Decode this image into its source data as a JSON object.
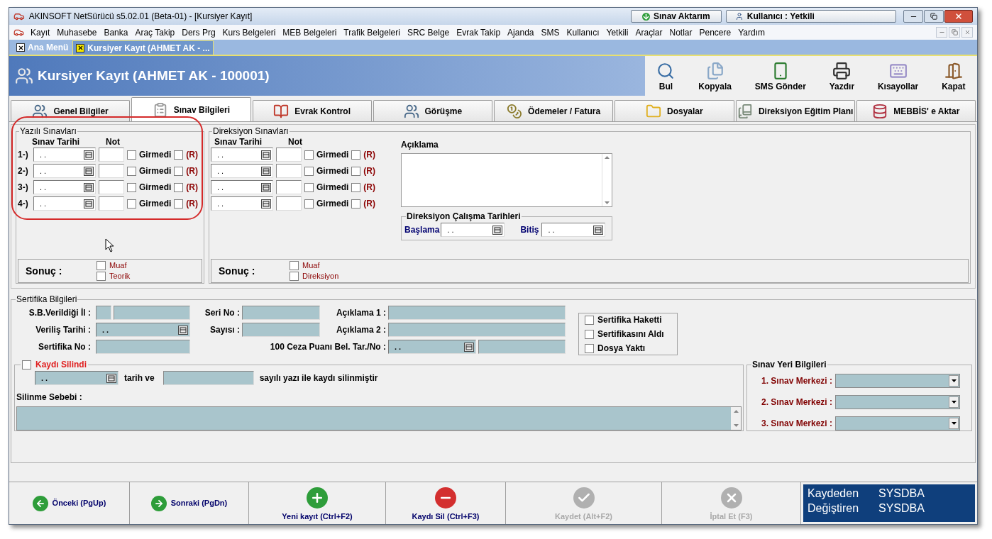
{
  "window": {
    "title": "AKINSOFT NetSürücü s5.02.01 (Beta-01) - [Kursiyer Kayıt]",
    "title_buttons": [
      {
        "label": "Sınav Aktarım",
        "kind": "transfer"
      },
      {
        "label": "Kullanıcı : Yetkili",
        "kind": "user"
      }
    ]
  },
  "menu": [
    "Kayıt",
    "Muhasebe",
    "Banka",
    "Araç Takip",
    "Ders Prg",
    "Kurs Belgeleri",
    "MEB Belgeleri",
    "Trafik Belgeleri",
    "SRC Belge",
    "Evrak Takip",
    "Ajanda",
    "SMS",
    "Kullanıcı",
    "Yetkili",
    "Araçlar",
    "Notlar",
    "Pencere",
    "Yardım"
  ],
  "doc_tabs": [
    {
      "label": "Ana Menü",
      "selected": false
    },
    {
      "label": "Kursiyer Kayıt (AHMET AK - ...",
      "selected": true
    }
  ],
  "header": {
    "title": "Kursiyer Kayıt (AHMET AK - 100001)",
    "tools": [
      {
        "label": "Bul",
        "kind": "find"
      },
      {
        "label": "Kopyala",
        "kind": "copy"
      },
      {
        "label": "SMS Gönder",
        "kind": "sms"
      },
      {
        "label": "Yazdır",
        "kind": "print"
      },
      {
        "label": "Kısayollar",
        "kind": "keyboard"
      },
      {
        "label": "Kapat",
        "kind": "close"
      }
    ]
  },
  "tabs": [
    {
      "label": "Genel Bilgiler",
      "kind": "people",
      "selected": false
    },
    {
      "label": "Sınav Bilgileri",
      "kind": "list",
      "selected": true
    },
    {
      "label": "Evrak Kontrol",
      "kind": "book",
      "selected": false
    },
    {
      "label": "Görüşme",
      "kind": "people",
      "selected": false
    },
    {
      "label": "Ödemeler / Fatura",
      "kind": "money",
      "selected": false
    },
    {
      "label": "Dosyalar",
      "kind": "folder",
      "selected": false
    },
    {
      "label": "Direksiyon Eğitim Planı",
      "kind": "plan",
      "selected": false
    },
    {
      "label": "MEBBİS' e Aktar",
      "kind": "export",
      "selected": false
    }
  ],
  "written_exams": {
    "title": "Yazılı Sınavları",
    "date_header": "Sınav Tarihi",
    "grade_header": "Not",
    "rows": [
      {
        "label": "1-)",
        "date": ". .",
        "absent_label": "Girmedi",
        "absent": false,
        "r_label": "(R)",
        "r": false
      },
      {
        "label": "2-)",
        "date": ". .",
        "absent_label": "Girmedi",
        "absent": false,
        "r_label": "(R)",
        "r": false
      },
      {
        "label": "3-)",
        "date": ". .",
        "absent_label": "Girmedi",
        "absent": false,
        "r_label": "(R)",
        "r": false
      },
      {
        "label": "4-)",
        "date": ". .",
        "absent_label": "Girmedi",
        "absent": false,
        "r_label": "(R)",
        "r": false
      }
    ],
    "result_label": "Sonuç :",
    "result_options": [
      {
        "label": "Muaf",
        "checked": false
      },
      {
        "label": "Teorik",
        "checked": false
      }
    ]
  },
  "driving_exams": {
    "title": "Direksiyon Sınavları",
    "date_header": "Sınav Tarihi",
    "grade_header": "Not",
    "rows": [
      {
        "label": "",
        "date": ". .",
        "absent_label": "Girmedi",
        "absent": false,
        "r_label": "(R)",
        "r": false
      },
      {
        "label": "",
        "date": ". .",
        "absent_label": "Girmedi",
        "absent": false,
        "r_label": "(R)",
        "r": false
      },
      {
        "label": "",
        "date": ". .",
        "absent_label": "Girmedi",
        "absent": false,
        "r_label": "(R)",
        "r": false
      },
      {
        "label": "",
        "date": ". .",
        "absent_label": "Girmedi",
        "absent": false,
        "r_label": "(R)",
        "r": false
      }
    ],
    "result_label": "Sonuç :",
    "result_options": [
      {
        "label": "Muaf",
        "checked": false
      },
      {
        "label": "Direksiyon",
        "checked": false
      }
    ]
  },
  "note": {
    "label": "Açıklama"
  },
  "practice_dates": {
    "title": "Direksiyon Çalışma Tarihleri",
    "start_label": "Başlama",
    "start": ". .",
    "end_label": "Bitiş",
    "end": ". ."
  },
  "certificate": {
    "title": "Sertifika Bilgileri",
    "province_label": "S.B.Verildiği İl :",
    "issue_date_label": "Veriliş Tarihi :",
    "issue_date": ". .",
    "number_label": "Sertifika No :",
    "serial_label": "Seri No :",
    "count_label": "Sayısı :",
    "note1_label": "Açıklama 1 :",
    "note2_label": "Açıklama 2 :",
    "penalty_label": "100 Ceza Puanı Bel. Tar./No :",
    "penalty_date": ". .",
    "flags": [
      {
        "label": "Sertifika Haketti",
        "checked": false
      },
      {
        "label": "Sertifikasını Aldı",
        "checked": false
      },
      {
        "label": "Dosya Yaktı",
        "checked": false
      }
    ]
  },
  "deletion": {
    "label": "Kaydı Silindi",
    "checked": false,
    "date": ". .",
    "middle_text": "tarih ve",
    "end_text": "sayılı yazı ile kaydı silinmiştir",
    "reason_label": "Silinme Sebebi :"
  },
  "exam_places": {
    "title": "Sınav Yeri Bilgileri",
    "items": [
      {
        "label": "1. Sınav Merkezi :"
      },
      {
        "label": "2. Sınav Merkezi :"
      },
      {
        "label": "3. Sınav Merkezi :"
      }
    ]
  },
  "footer_buttons": [
    {
      "label": "Önceki (PgUp)",
      "kind": "prev",
      "disabled": false
    },
    {
      "label": "Sonraki (PgDn)",
      "kind": "next",
      "disabled": false
    },
    {
      "label": "Yeni kayıt (Ctrl+F2)",
      "kind": "add",
      "disabled": false
    },
    {
      "label": "Kaydı Sil (Ctrl+F3)",
      "kind": "delete",
      "disabled": false
    },
    {
      "label": "Kaydet (Alt+F2)",
      "kind": "save",
      "disabled": true
    },
    {
      "label": "İptal Et (F3)",
      "kind": "cancel",
      "disabled": true
    }
  ],
  "record_info": [
    {
      "label": "Kaydeden",
      "value": "SYSDBA"
    },
    {
      "label": "Değiştiren",
      "value": "SYSDBA"
    }
  ]
}
